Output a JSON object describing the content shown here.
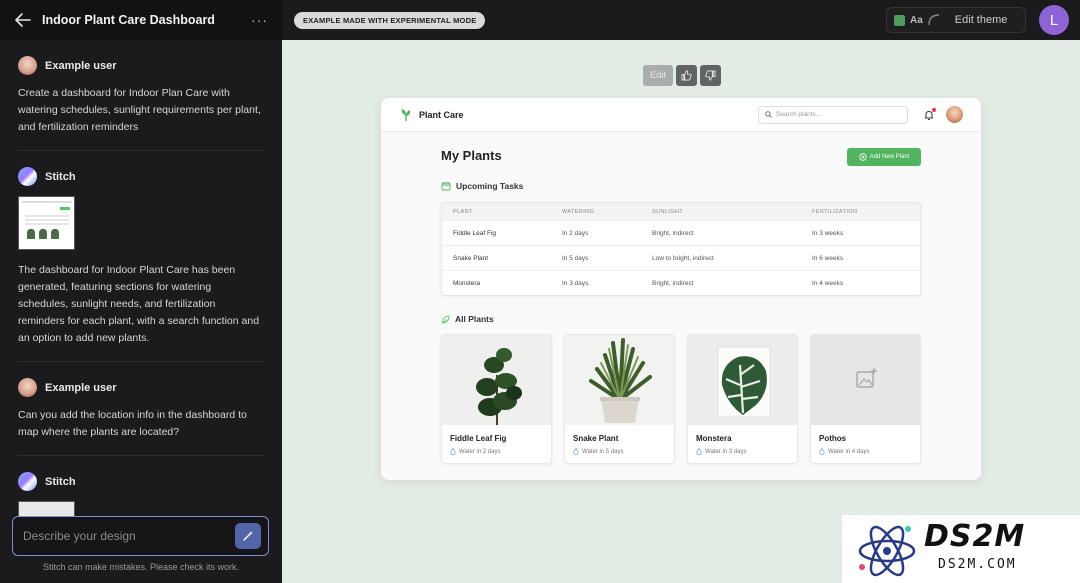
{
  "left_panel": {
    "title": "Indoor Plant Care Dashboard",
    "messages": [
      {
        "author": "Example user",
        "text": "Create a dashboard for Indoor Plan Care with watering schedules, sunlight requirements per plant, and fertilization reminders"
      },
      {
        "author": "Stitch",
        "text": "The dashboard for Indoor Plant Care has been generated, featuring sections for watering schedules, sunlight needs, and fertilization reminders for each plant, with a search function and an option to add new plants."
      },
      {
        "author": "Example user",
        "text": "Can you add the location info in the dashboard to map where the plants are located?"
      },
      {
        "author": "Stitch",
        "text": ""
      }
    ],
    "input_placeholder": "Describe your design",
    "disclaimer": "Stitch can make mistakes. Please check its work."
  },
  "topbar": {
    "badge": "EXAMPLE MADE WITH EXPERIMENTAL MODE",
    "theme_aa": "Aa",
    "edit_theme": "Edit theme",
    "user_initial": "L",
    "user_color": "#8e63d6"
  },
  "canvas_controls": {
    "edit": "Edit"
  },
  "preview": {
    "brand": "Plant Care",
    "search_placeholder": "Search plants...",
    "page_title": "My Plants",
    "add_button": "Add New Plant",
    "tasks_heading": "Upcoming Tasks",
    "table": {
      "headers": [
        "PLANT",
        "WATERING",
        "SUNLIGHT",
        "FERTILIZATION"
      ],
      "rows": [
        [
          "Fiddle Leaf Fig",
          "In 2 days",
          "Bright, indirect",
          "In 3 weeks"
        ],
        [
          "Snake Plant",
          "In 5 days",
          "Low to bright, indirect",
          "In 6 weeks"
        ],
        [
          "Monstera",
          "In 3 days",
          "Bright, indirect",
          "In 4 weeks"
        ]
      ]
    },
    "plants_heading": "All Plants",
    "plants": [
      {
        "name": "Fiddle Leaf Fig",
        "water": "Water in 2 days"
      },
      {
        "name": "Snake Plant",
        "water": "Water in 5 days"
      },
      {
        "name": "Monstera",
        "water": "Water in 3 days"
      },
      {
        "name": "Pothos",
        "water": "Water in 4 days"
      }
    ],
    "accent": "#52b45e"
  },
  "watermark": {
    "big": "DS2M",
    "small": "DS2M.COM"
  }
}
